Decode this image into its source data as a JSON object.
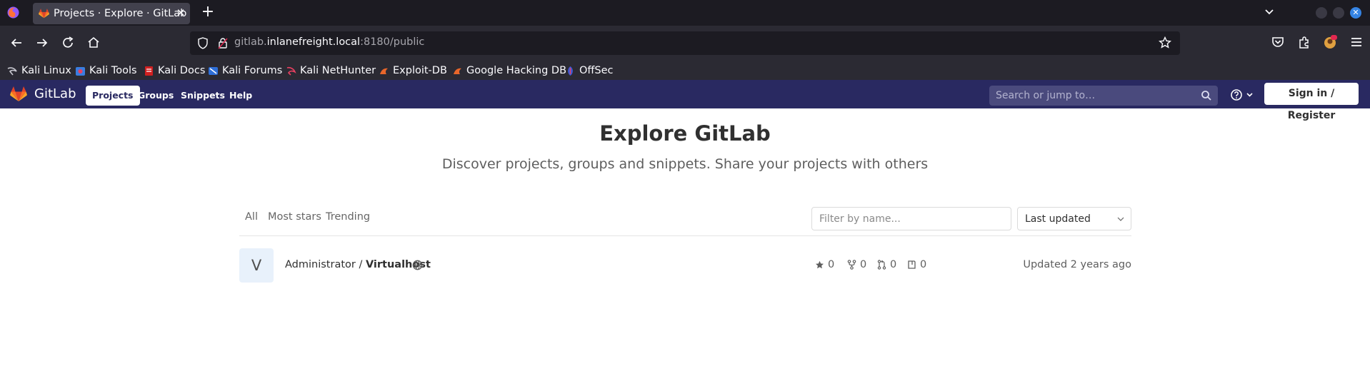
{
  "browser": {
    "tab_title": "Projects · Explore · GitLab",
    "url_host_prefix": "gitlab.",
    "url_host": "inlanefreight.local",
    "url_rest": ":8180/public"
  },
  "bookmarks": [
    {
      "label": "Kali Linux",
      "icon": "kali-dragon-icon"
    },
    {
      "label": "Kali Tools",
      "icon": "kali-tools-icon"
    },
    {
      "label": "Kali Docs",
      "icon": "kali-docs-icon"
    },
    {
      "label": "Kali Forums",
      "icon": "kali-forums-icon"
    },
    {
      "label": "Kali NetHunter",
      "icon": "nethunter-icon"
    },
    {
      "label": "Exploit-DB",
      "icon": "exploitdb-icon"
    },
    {
      "label": "Google Hacking DB",
      "icon": "ghdb-icon"
    },
    {
      "label": "OffSec",
      "icon": "offsec-icon"
    }
  ],
  "gitlab_header": {
    "brand": "GitLab",
    "nav": [
      "Projects",
      "Groups",
      "Snippets",
      "Help"
    ],
    "search_placeholder": "Search or jump to…",
    "signin_label": "Sign in / Register"
  },
  "main": {
    "title": "Explore GitLab",
    "subtitle": "Discover projects, groups and snippets. Share your projects with others",
    "filter_tabs": [
      "All",
      "Most stars",
      "Trending"
    ],
    "filter_placeholder": "Filter by name...",
    "sort_selected": "Last updated"
  },
  "project": {
    "avatar_letter": "V",
    "namespace": "Administrator / ",
    "name": "Virtualhost",
    "stars": "0",
    "forks": "0",
    "merge_requests": "0",
    "issues": "0",
    "updated": "Updated 2 years ago"
  },
  "colors": {
    "gitlab_header": "#292961",
    "browser_bg": "#2b2a33",
    "tabbar_bg": "#1c1b22",
    "accent_close": "#3584e4"
  }
}
